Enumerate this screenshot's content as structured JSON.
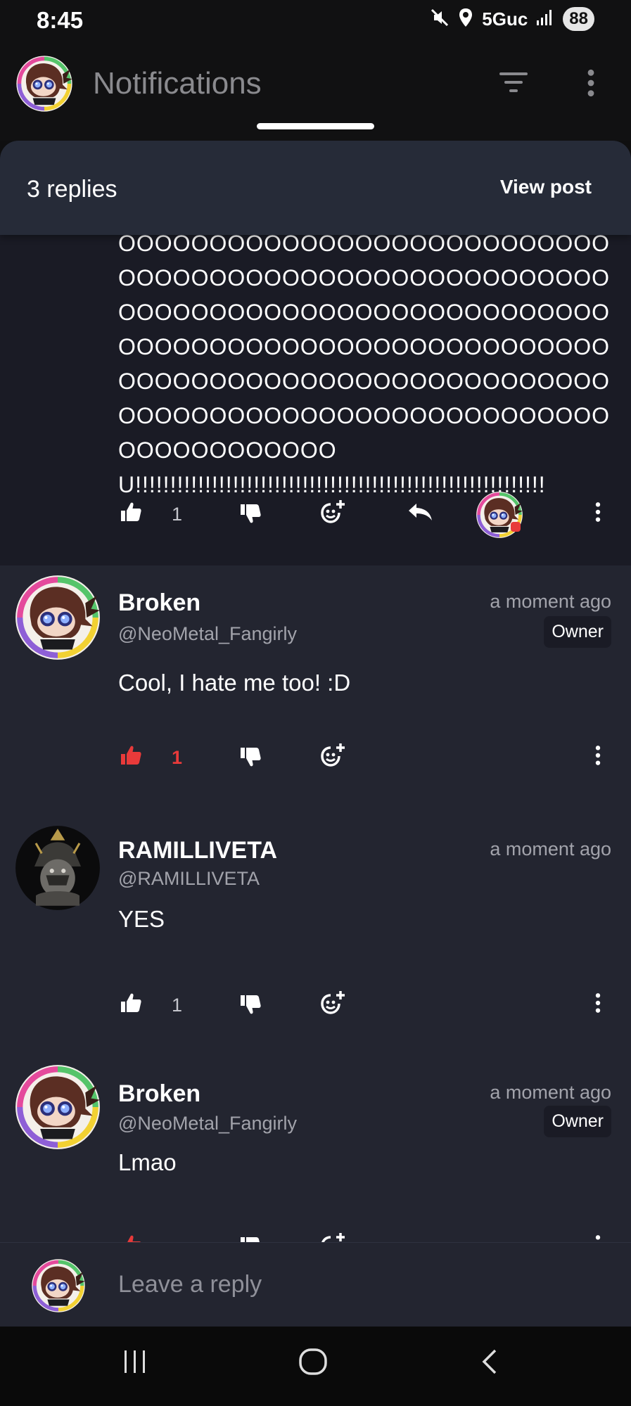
{
  "status_bar": {
    "time": "8:45",
    "network": "5Guc",
    "battery": "88",
    "icons": [
      "mute-icon",
      "location-icon",
      "signal-icon"
    ]
  },
  "header": {
    "title": "Notifications",
    "icons": [
      "avatar",
      "filter-icon",
      "more-vert-icon"
    ]
  },
  "sheet": {
    "replies_label": "3 replies",
    "view_post_label": "View post"
  },
  "parent_post": {
    "text": "OOOOOOOOOOOOOOOOOOOOOOOOOOOOOOOOOOOOOOOOOOOOOOOOOOOOOOOOOOOOOOOOOOOOOOOOOOOOOOOOOOOOOOOOOOOOOOOOOOOOOOOOOOOOOOOOOOOOOOOOOOOOOOOOOOOOOOOOOOOOOOOOOOOOOOOOOOOOOOOOOOOOOOOOOOOOOOU!!!!!!!!!!!!!!!!!!!!!!!!!!!!!!!!!!!!!!!!!!!!!!!!!!!!!!!!!!!",
    "likes": "1"
  },
  "replies": [
    {
      "author": "Broken",
      "handle": "@NeoMetal_Fangirly",
      "time": "a moment ago",
      "badge": "Owner",
      "text": "Cool, I hate me too! :D",
      "likes": "1",
      "liked": true
    },
    {
      "author": "RAMILLIVETA",
      "handle": "@RAMILLIVETA",
      "time": "a moment ago",
      "badge": "",
      "text": "YES",
      "likes": "1",
      "liked": false
    },
    {
      "author": "Broken",
      "handle": "@NeoMetal_Fangirly",
      "time": "a moment ago",
      "badge": "Owner",
      "text": "Lmao",
      "likes": "",
      "liked": true
    }
  ],
  "composer": {
    "placeholder": "Leave a reply"
  },
  "colors": {
    "background": "#1a1b25",
    "reply_background": "#232530",
    "liked": "#e83a3a",
    "muted_text": "#a2a3ab"
  }
}
